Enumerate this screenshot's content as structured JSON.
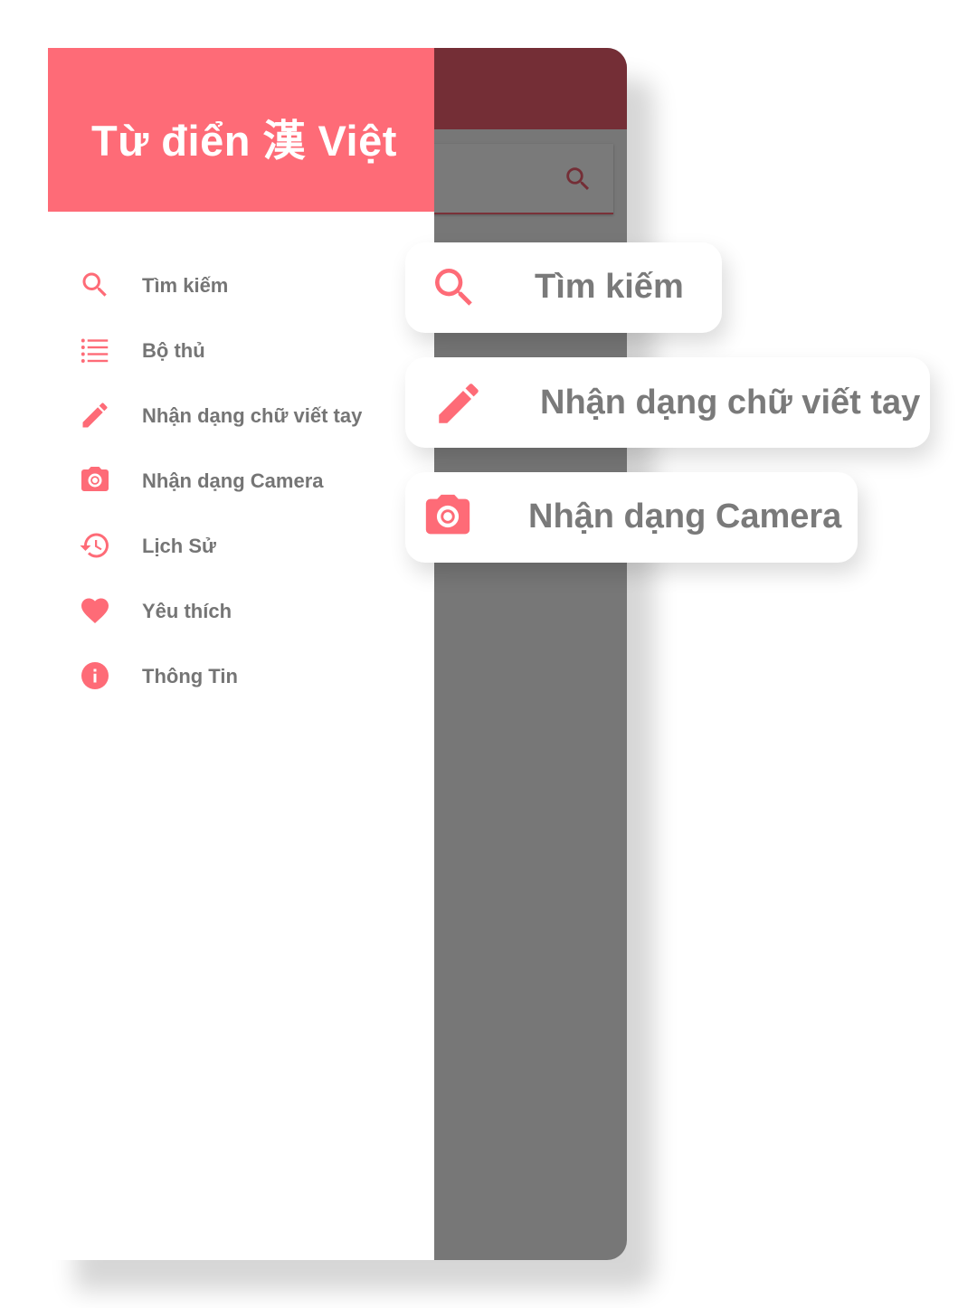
{
  "colors": {
    "accent": "#fe6b77",
    "header_dark": "#742e36",
    "scrim": "#777777",
    "text_gray": "#757575"
  },
  "drawer": {
    "title": "Từ điển 漢 Việt",
    "items": [
      {
        "icon": "search-icon",
        "label": "Tìm kiếm"
      },
      {
        "icon": "list-icon",
        "label": "Bộ thủ"
      },
      {
        "icon": "pencil-icon",
        "label": "Nhận dạng chữ viết tay"
      },
      {
        "icon": "camera-icon",
        "label": "Nhận dạng Camera"
      },
      {
        "icon": "history-icon",
        "label": "Lịch Sử"
      },
      {
        "icon": "heart-icon",
        "label": "Yêu thích"
      },
      {
        "icon": "info-icon",
        "label": "Thông Tin"
      }
    ]
  },
  "app_behind": {
    "search_icon": "search-icon"
  },
  "callouts": [
    {
      "icon": "search-icon",
      "label": "Tìm kiếm"
    },
    {
      "icon": "pencil-icon",
      "label": "Nhận dạng chữ viết tay"
    },
    {
      "icon": "camera-icon",
      "label": "Nhận dạng Camera"
    }
  ]
}
